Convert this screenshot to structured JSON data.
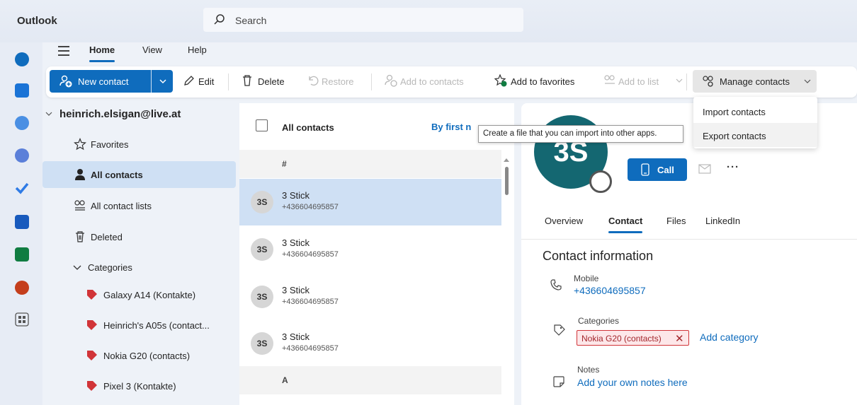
{
  "app": {
    "name": "Outlook"
  },
  "search": {
    "placeholder": "Search"
  },
  "ribbon": {
    "tabs": [
      {
        "label": "Home",
        "active": true
      },
      {
        "label": "View",
        "active": false
      },
      {
        "label": "Help",
        "active": false
      }
    ]
  },
  "commands": {
    "new_contact": "New contact",
    "edit": "Edit",
    "delete": "Delete",
    "restore": "Restore",
    "add_to_contacts": "Add to contacts",
    "add_to_favorites": "Add to favorites",
    "add_to_list": "Add to list",
    "manage_contacts": "Manage contacts"
  },
  "manage_menu": {
    "items": [
      {
        "label": "Import contacts"
      },
      {
        "label": "Export contacts"
      }
    ]
  },
  "tooltip": {
    "text": "Create a file that you can import into other apps."
  },
  "folders": {
    "account": "heinrich.elsigan@live.at",
    "items": [
      {
        "label": "Favorites",
        "icon": "star-icon"
      },
      {
        "label": "All contacts",
        "icon": "person-icon",
        "selected": true
      },
      {
        "label": "All contact lists",
        "icon": "people-list-icon"
      },
      {
        "label": "Deleted",
        "icon": "trash-icon"
      },
      {
        "label": "Categories",
        "icon": "chevron-down-icon"
      }
    ],
    "categories": [
      {
        "label": "Galaxy A14 (Kontakte)",
        "color": "#d13438"
      },
      {
        "label": "Heinrich's A05s (contact...",
        "color": "#d13438"
      },
      {
        "label": "Nokia G20 (contacts)",
        "color": "#d13438"
      },
      {
        "label": "Pixel 3 (Kontakte)",
        "color": "#d13438"
      }
    ]
  },
  "contact_list": {
    "title": "All contacts",
    "sort": "By first n",
    "groups": [
      {
        "label": "#"
      },
      {
        "label": "A"
      }
    ],
    "contacts": [
      {
        "initials": "3S",
        "name": "3 Stick",
        "phone": "+436604695857",
        "selected": true
      },
      {
        "initials": "3S",
        "name": "3 Stick",
        "phone": "+436604695857"
      },
      {
        "initials": "3S",
        "name": "3 Stick",
        "phone": "+436604695857"
      },
      {
        "initials": "3S",
        "name": "3 Stick",
        "phone": "+436604695857"
      }
    ]
  },
  "details": {
    "initials": "3S",
    "call": "Call",
    "more": "···",
    "tabs": [
      {
        "label": "Overview"
      },
      {
        "label": "Contact",
        "active": true
      },
      {
        "label": "Files"
      },
      {
        "label": "LinkedIn"
      }
    ],
    "section_title": "Contact information",
    "mobile_label": "Mobile",
    "mobile_value": "+436604695857",
    "categories_label": "Categories",
    "category_chip": "Nokia G20 (contacts)",
    "add_category": "Add category",
    "notes_label": "Notes",
    "notes_placeholder": "Add your own notes here"
  },
  "colors": {
    "accent": "#0f6cbd",
    "avatar": "#146771",
    "selection": "#cfe0f4",
    "category": "#d13438"
  }
}
